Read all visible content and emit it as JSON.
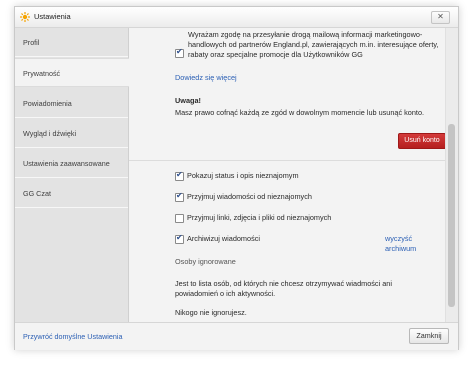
{
  "window": {
    "title": "Ustawienia"
  },
  "sidebar": {
    "items": [
      {
        "label": "Profil"
      },
      {
        "label": "Prywatność"
      },
      {
        "label": "Powiadomienia"
      },
      {
        "label": "Wygląd i dźwięki"
      },
      {
        "label": "Ustawienia zaawansowane"
      },
      {
        "label": "GG Czat"
      }
    ],
    "active_index": 1
  },
  "content": {
    "marketing_consent": {
      "checked": true,
      "line1": "Wyrażam zgodę na przesyłanie drogą mailową informacji marketingowo-",
      "line2": "handlowych od partnerów England.pl, zawierających m.in. interesujące oferty,",
      "line3": "rabaty oraz specjalne promocje dla Użytkowników GG"
    },
    "learn_more_link": "Dowiedz się więcej",
    "warning": {
      "title": "Uwaga!",
      "text": "Masz prawo cofnąć każdą ze zgód w dowolnym momencie lub usunąć konto."
    },
    "delete_account_button": "Usuń konto",
    "options": [
      {
        "label": "Pokazuj status i opis nieznajomym",
        "checked": true
      },
      {
        "label": "Przyjmuj wiadomości od nieznajomych",
        "checked": true
      },
      {
        "label": "Przyjmuj linki, zdjęcia i pliki od nieznajomych",
        "checked": false
      },
      {
        "label": "Archiwizuj wiadomości",
        "checked": true
      }
    ],
    "clear_archive_link": "wyczyść archiwum",
    "ignored": {
      "heading": "Osoby ignorowane",
      "description_line1": "Jest to lista osób, od których nie chcesz otrzymywać wiadmości ani",
      "description_line2": "powiadomień o ich aktywności.",
      "empty_text": "Nikogo nie ignorujesz."
    }
  },
  "footer": {
    "restore_defaults_link": "Przywróć domyślne Ustawienia",
    "close_button": "Zamknij"
  },
  "colors": {
    "accent_link": "#2b5fb4",
    "danger": "#c62828",
    "icon": "#f5a300"
  },
  "icons": {
    "app": "gear-sun-icon",
    "window_close": "close-icon"
  }
}
